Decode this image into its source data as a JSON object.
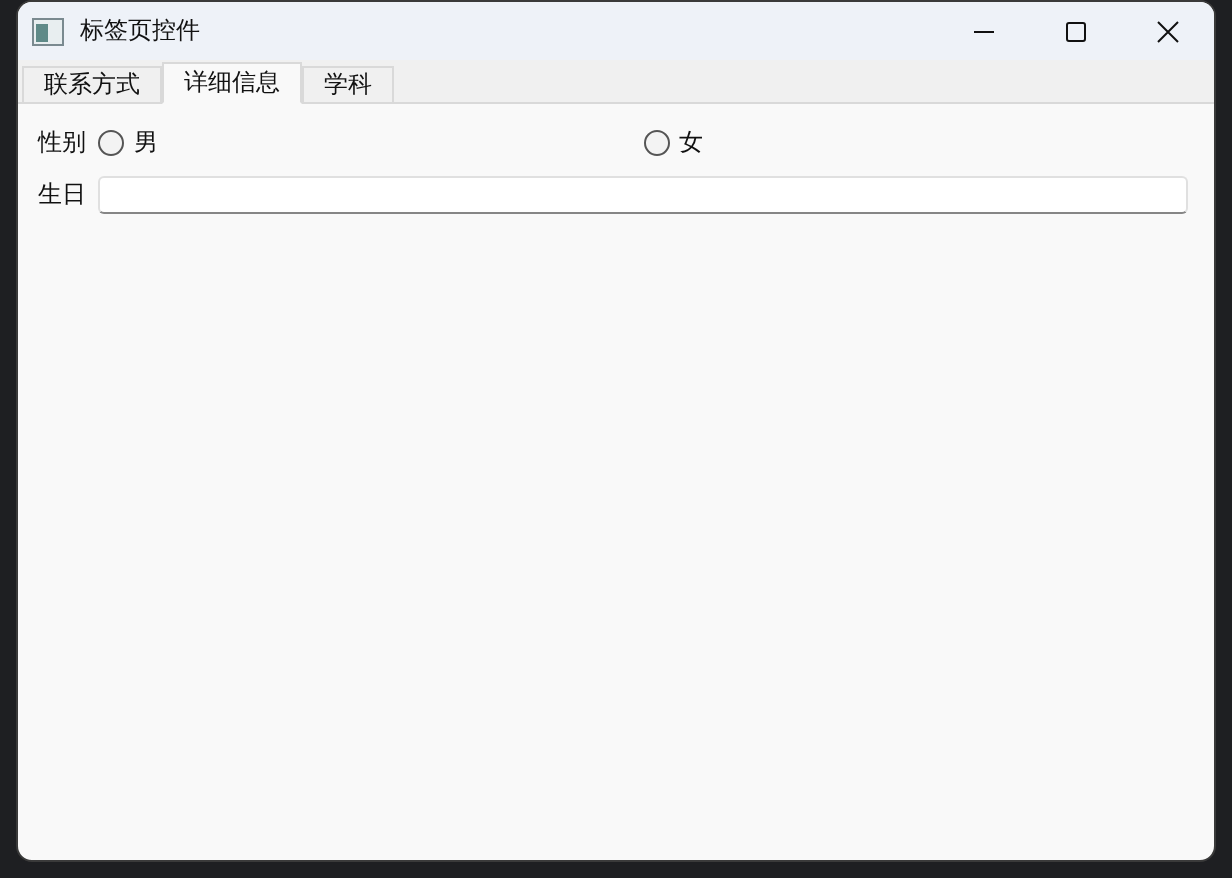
{
  "window": {
    "title": "标签页控件"
  },
  "tabs": [
    {
      "label": "联系方式",
      "selected": false
    },
    {
      "label": "详细信息",
      "selected": true
    },
    {
      "label": "学科",
      "selected": false
    }
  ],
  "form": {
    "gender": {
      "label": "性别",
      "options": [
        {
          "label": "男",
          "selected": false
        },
        {
          "label": "女",
          "selected": false
        }
      ]
    },
    "birthday": {
      "label": "生日"
    }
  }
}
